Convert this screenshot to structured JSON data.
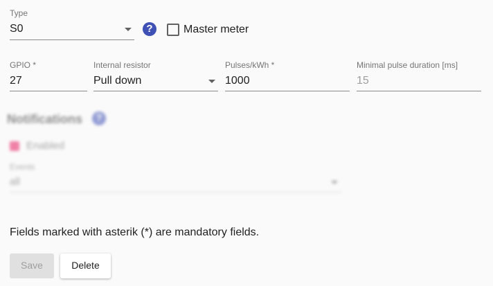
{
  "type_field": {
    "label": "Type",
    "value": "S0"
  },
  "help_glyph": "?",
  "master_meter": {
    "label": "Master meter",
    "checked": false
  },
  "gpio": {
    "label": "GPIO *",
    "value": "27"
  },
  "internal_resistor": {
    "label": "Internal resistor",
    "value": "Pull down"
  },
  "pulses": {
    "label": "Pulses/kWh *",
    "value": "1000"
  },
  "min_pulse": {
    "label": "Minimal pulse duration [ms]",
    "value": "15"
  },
  "notifications": {
    "heading": "Notifications",
    "enabled_label": "Enabled",
    "enabled_checked": true,
    "events_label": "Events",
    "events_value": "all"
  },
  "mandatory_note": "Fields marked with asterik (*) are mandatory fields.",
  "buttons": {
    "save": "Save",
    "delete": "Delete"
  },
  "colors": {
    "accent": "#3f51b5",
    "checkbox_checked": "#e91e63"
  }
}
